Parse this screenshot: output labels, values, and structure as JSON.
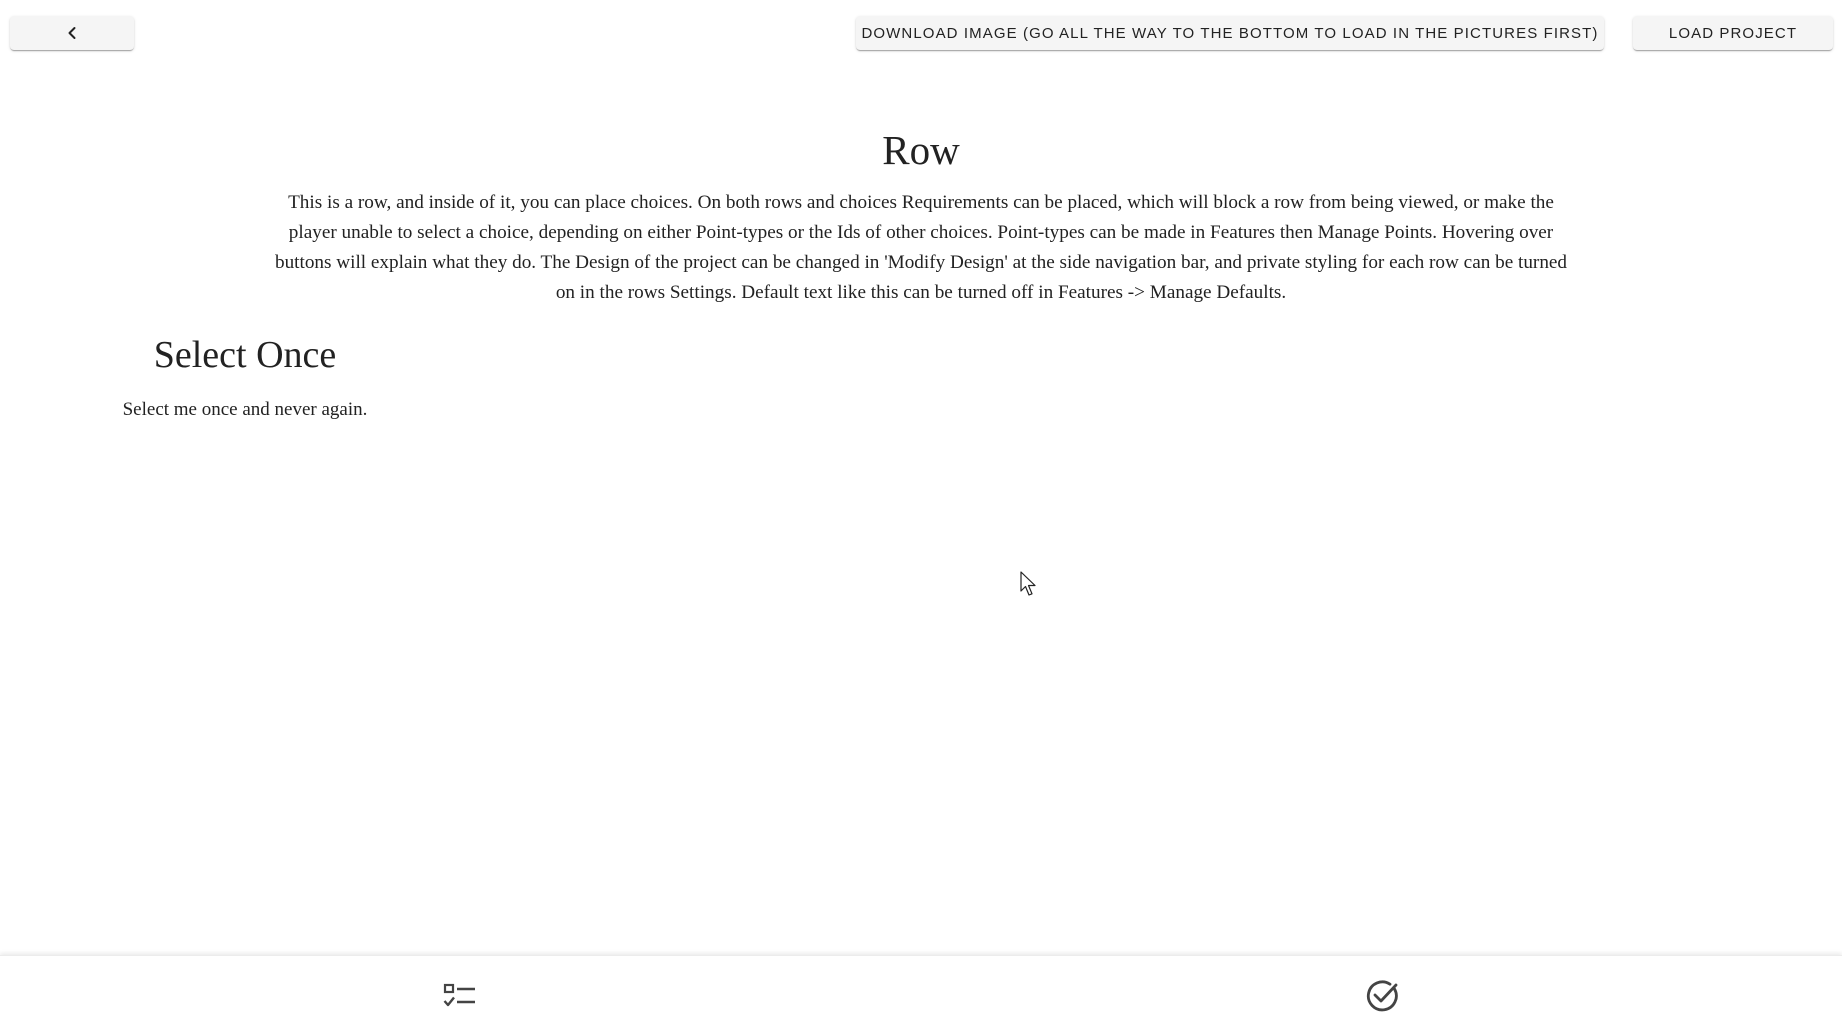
{
  "toolbar": {
    "back_icon": "chevron-left-icon",
    "download_label": "DOWNLOAD IMAGE (GO ALL THE WAY TO THE BOTTOM TO LOAD IN THE PICTURES FIRST)",
    "load_label": "LOAD PROJECT"
  },
  "row": {
    "title": "Row",
    "text": "This is a row, and inside of it, you can place choices. On both rows and choices Requirements can be placed, which will block a row from being viewed, or make the player unable to select a choice, depending on either Point-types or the Ids of other choices. Point-types can be made in Features then Manage Points. Hovering over buttons will explain what they do. The Design of the project can be changed in 'Modify Design' at the side navigation bar, and private styling for each row can be turned on in the rows Settings. Default text like this can be turned off in Features -> Manage Defaults."
  },
  "choice": {
    "title": "Select Once",
    "text": "Select me once and never again."
  },
  "bottom_nav": {
    "left_icon": "checklist-icon",
    "right_icon": "check-circle-icon"
  }
}
